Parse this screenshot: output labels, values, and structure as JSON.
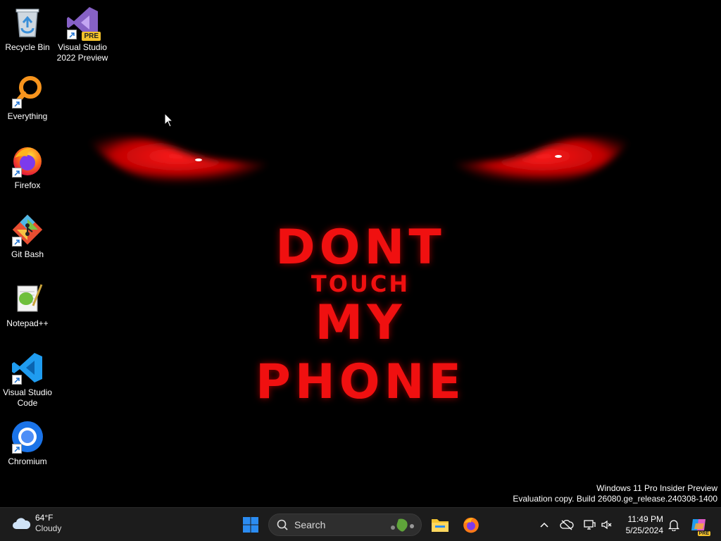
{
  "wallpaper": {
    "line1": "DONT",
    "line2": "TOUCH",
    "line3": "MY",
    "line4": "PHONE",
    "text_color": "#f01010"
  },
  "desktop_icons": [
    {
      "label": "Recycle Bin",
      "icon": "recycle-bin-icon"
    },
    {
      "label": "Visual Studio\n2022 Preview",
      "icon": "visual-studio-icon",
      "badge": "PRE"
    },
    {
      "label": "Everything",
      "icon": "everything-search-icon"
    },
    {
      "label": "Firefox",
      "icon": "firefox-icon"
    },
    {
      "label": "Git Bash",
      "icon": "git-bash-icon"
    },
    {
      "label": "Notepad++",
      "icon": "notepad-plus-plus-icon"
    },
    {
      "label": "Visual Studio\nCode",
      "icon": "vscode-icon"
    },
    {
      "label": "Chromium",
      "icon": "chromium-icon"
    }
  ],
  "watermark": {
    "line1": "Windows 11 Pro Insider Preview",
    "line2": "Evaluation copy. Build 26080.ge_release.240308-1400"
  },
  "taskbar": {
    "weather": {
      "temp": "64°F",
      "condition": "Cloudy",
      "icon": "cloud-icon"
    },
    "search_label": "Search",
    "clock": {
      "time": "11:49 PM",
      "date": "5/25/2024"
    },
    "copilot_badge": "PRE",
    "accent": "#2b8cf2"
  }
}
